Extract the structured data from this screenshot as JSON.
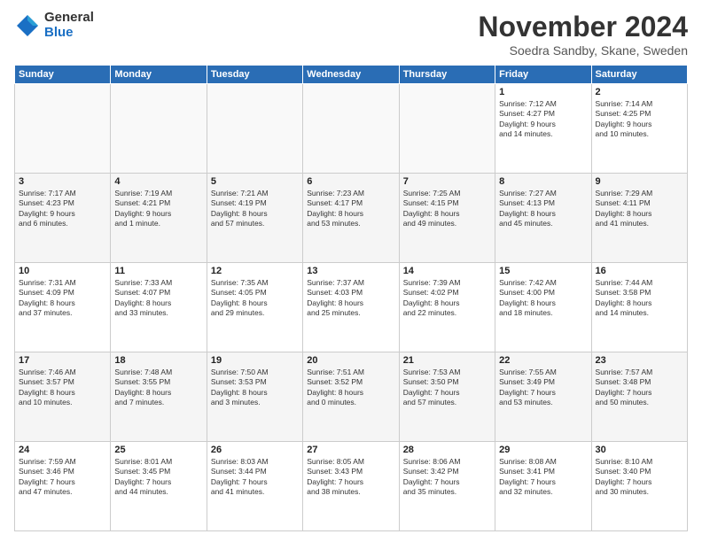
{
  "logo": {
    "general": "General",
    "blue": "Blue"
  },
  "title": "November 2024",
  "location": "Soedra Sandby, Skane, Sweden",
  "days_of_week": [
    "Sunday",
    "Monday",
    "Tuesday",
    "Wednesday",
    "Thursday",
    "Friday",
    "Saturday"
  ],
  "weeks": [
    [
      {
        "day": "",
        "info": ""
      },
      {
        "day": "",
        "info": ""
      },
      {
        "day": "",
        "info": ""
      },
      {
        "day": "",
        "info": ""
      },
      {
        "day": "",
        "info": ""
      },
      {
        "day": "1",
        "info": "Sunrise: 7:12 AM\nSunset: 4:27 PM\nDaylight: 9 hours\nand 14 minutes."
      },
      {
        "day": "2",
        "info": "Sunrise: 7:14 AM\nSunset: 4:25 PM\nDaylight: 9 hours\nand 10 minutes."
      }
    ],
    [
      {
        "day": "3",
        "info": "Sunrise: 7:17 AM\nSunset: 4:23 PM\nDaylight: 9 hours\nand 6 minutes."
      },
      {
        "day": "4",
        "info": "Sunrise: 7:19 AM\nSunset: 4:21 PM\nDaylight: 9 hours\nand 1 minute."
      },
      {
        "day": "5",
        "info": "Sunrise: 7:21 AM\nSunset: 4:19 PM\nDaylight: 8 hours\nand 57 minutes."
      },
      {
        "day": "6",
        "info": "Sunrise: 7:23 AM\nSunset: 4:17 PM\nDaylight: 8 hours\nand 53 minutes."
      },
      {
        "day": "7",
        "info": "Sunrise: 7:25 AM\nSunset: 4:15 PM\nDaylight: 8 hours\nand 49 minutes."
      },
      {
        "day": "8",
        "info": "Sunrise: 7:27 AM\nSunset: 4:13 PM\nDaylight: 8 hours\nand 45 minutes."
      },
      {
        "day": "9",
        "info": "Sunrise: 7:29 AM\nSunset: 4:11 PM\nDaylight: 8 hours\nand 41 minutes."
      }
    ],
    [
      {
        "day": "10",
        "info": "Sunrise: 7:31 AM\nSunset: 4:09 PM\nDaylight: 8 hours\nand 37 minutes."
      },
      {
        "day": "11",
        "info": "Sunrise: 7:33 AM\nSunset: 4:07 PM\nDaylight: 8 hours\nand 33 minutes."
      },
      {
        "day": "12",
        "info": "Sunrise: 7:35 AM\nSunset: 4:05 PM\nDaylight: 8 hours\nand 29 minutes."
      },
      {
        "day": "13",
        "info": "Sunrise: 7:37 AM\nSunset: 4:03 PM\nDaylight: 8 hours\nand 25 minutes."
      },
      {
        "day": "14",
        "info": "Sunrise: 7:39 AM\nSunset: 4:02 PM\nDaylight: 8 hours\nand 22 minutes."
      },
      {
        "day": "15",
        "info": "Sunrise: 7:42 AM\nSunset: 4:00 PM\nDaylight: 8 hours\nand 18 minutes."
      },
      {
        "day": "16",
        "info": "Sunrise: 7:44 AM\nSunset: 3:58 PM\nDaylight: 8 hours\nand 14 minutes."
      }
    ],
    [
      {
        "day": "17",
        "info": "Sunrise: 7:46 AM\nSunset: 3:57 PM\nDaylight: 8 hours\nand 10 minutes."
      },
      {
        "day": "18",
        "info": "Sunrise: 7:48 AM\nSunset: 3:55 PM\nDaylight: 8 hours\nand 7 minutes."
      },
      {
        "day": "19",
        "info": "Sunrise: 7:50 AM\nSunset: 3:53 PM\nDaylight: 8 hours\nand 3 minutes."
      },
      {
        "day": "20",
        "info": "Sunrise: 7:51 AM\nSunset: 3:52 PM\nDaylight: 8 hours\nand 0 minutes."
      },
      {
        "day": "21",
        "info": "Sunrise: 7:53 AM\nSunset: 3:50 PM\nDaylight: 7 hours\nand 57 minutes."
      },
      {
        "day": "22",
        "info": "Sunrise: 7:55 AM\nSunset: 3:49 PM\nDaylight: 7 hours\nand 53 minutes."
      },
      {
        "day": "23",
        "info": "Sunrise: 7:57 AM\nSunset: 3:48 PM\nDaylight: 7 hours\nand 50 minutes."
      }
    ],
    [
      {
        "day": "24",
        "info": "Sunrise: 7:59 AM\nSunset: 3:46 PM\nDaylight: 7 hours\nand 47 minutes."
      },
      {
        "day": "25",
        "info": "Sunrise: 8:01 AM\nSunset: 3:45 PM\nDaylight: 7 hours\nand 44 minutes."
      },
      {
        "day": "26",
        "info": "Sunrise: 8:03 AM\nSunset: 3:44 PM\nDaylight: 7 hours\nand 41 minutes."
      },
      {
        "day": "27",
        "info": "Sunrise: 8:05 AM\nSunset: 3:43 PM\nDaylight: 7 hours\nand 38 minutes."
      },
      {
        "day": "28",
        "info": "Sunrise: 8:06 AM\nSunset: 3:42 PM\nDaylight: 7 hours\nand 35 minutes."
      },
      {
        "day": "29",
        "info": "Sunrise: 8:08 AM\nSunset: 3:41 PM\nDaylight: 7 hours\nand 32 minutes."
      },
      {
        "day": "30",
        "info": "Sunrise: 8:10 AM\nSunset: 3:40 PM\nDaylight: 7 hours\nand 30 minutes."
      }
    ]
  ]
}
